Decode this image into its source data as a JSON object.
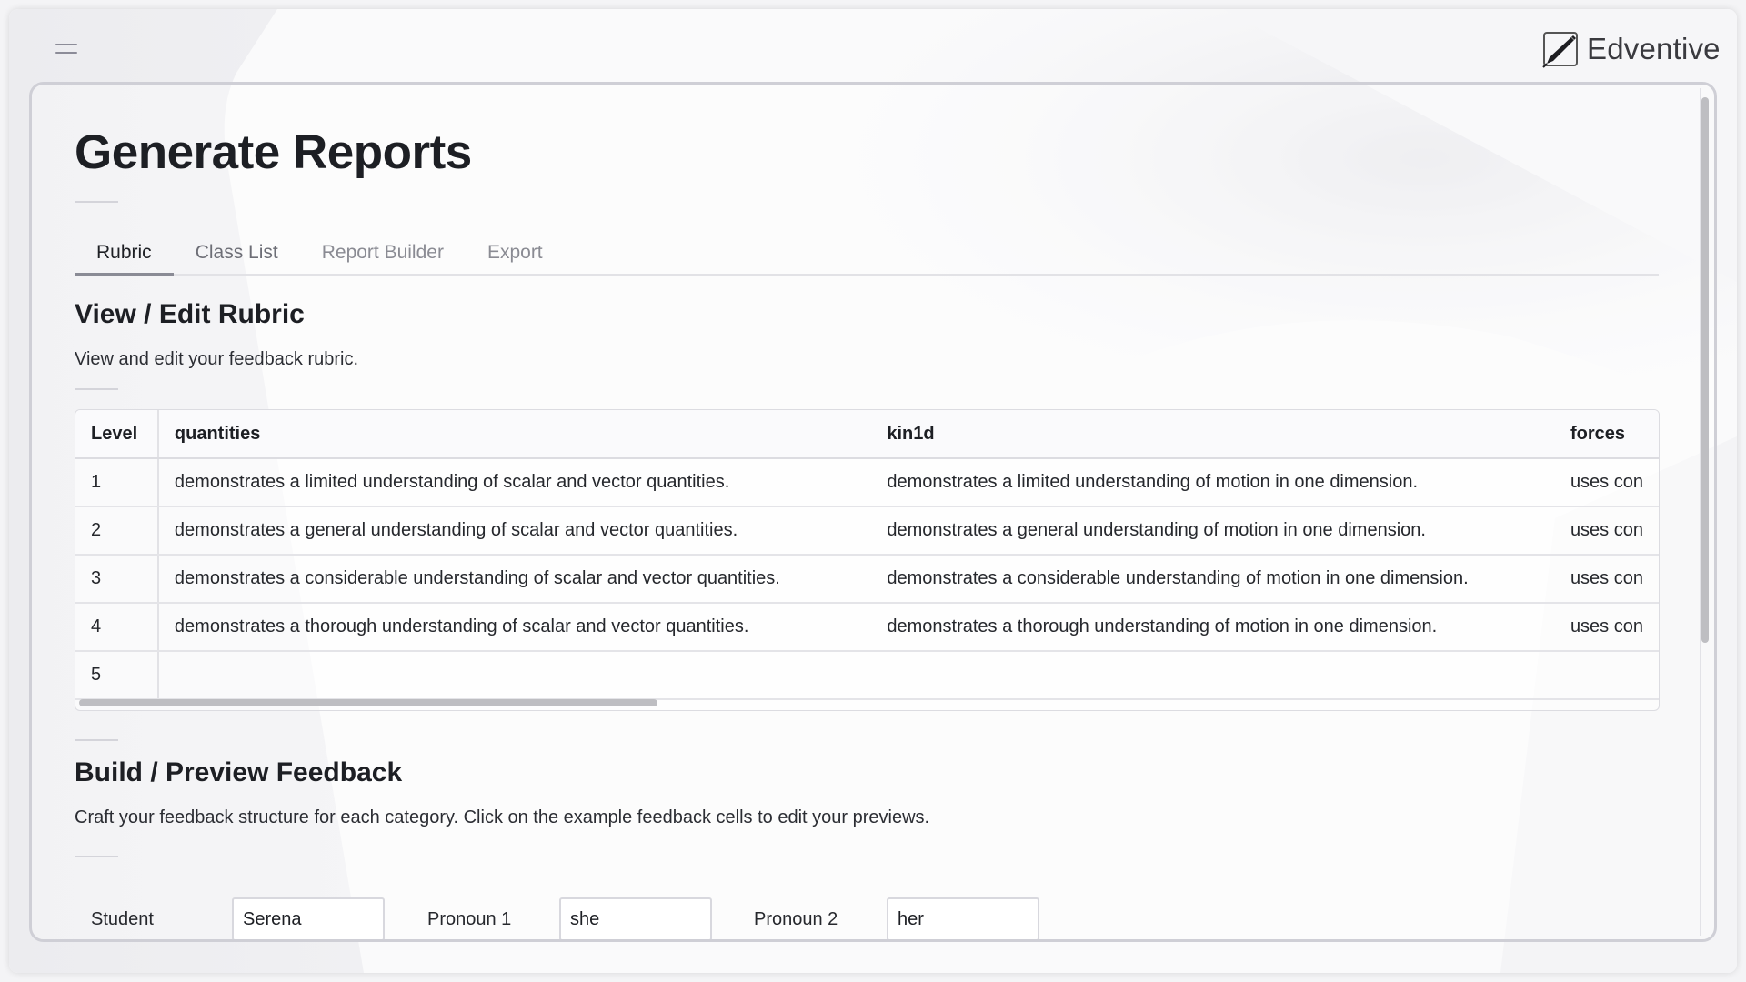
{
  "app": {
    "brand": "Edventive",
    "menu_icon": "hamburger-menu-icon",
    "logo_icon": "pen-icon"
  },
  "page": {
    "title": "Generate Reports"
  },
  "tabs": [
    {
      "label": "Rubric",
      "active": true
    },
    {
      "label": "Class List",
      "active": false
    },
    {
      "label": "Report Builder",
      "active": false
    },
    {
      "label": "Export",
      "active": false
    }
  ],
  "rubric_section": {
    "heading": "View / Edit Rubric",
    "description": "View and edit your feedback rubric.",
    "table": {
      "columns": [
        "Level",
        "quantities",
        "kin1d",
        "forces"
      ],
      "rows": [
        {
          "level": "1",
          "quantities": "demonstrates a limited understanding of scalar and vector quantities.",
          "kin1d": "demonstrates a limited understanding of motion in one dimension.",
          "forces": "uses con"
        },
        {
          "level": "2",
          "quantities": "demonstrates a general understanding of scalar and vector quantities.",
          "kin1d": "demonstrates a general understanding of motion in one dimension.",
          "forces": "uses con"
        },
        {
          "level": "3",
          "quantities": "demonstrates a considerable understanding of scalar and vector quantities.",
          "kin1d": "demonstrates a considerable understanding of motion in one dimension.",
          "forces": "uses con"
        },
        {
          "level": "4",
          "quantities": "demonstrates a thorough understanding of scalar and vector quantities.",
          "kin1d": "demonstrates a thorough understanding of motion in one dimension.",
          "forces": "uses con"
        },
        {
          "level": "5",
          "quantities": "",
          "kin1d": "",
          "forces": ""
        }
      ]
    }
  },
  "feedback_section": {
    "heading": "Build / Preview Feedback",
    "description": "Craft your feedback structure for each category. Click on the example feedback cells to edit your previews.",
    "fields": [
      {
        "label": "Student",
        "value": "Serena"
      },
      {
        "label": "Pronoun 1",
        "value": "she"
      },
      {
        "label": "Pronoun 2",
        "value": "her"
      }
    ]
  }
}
